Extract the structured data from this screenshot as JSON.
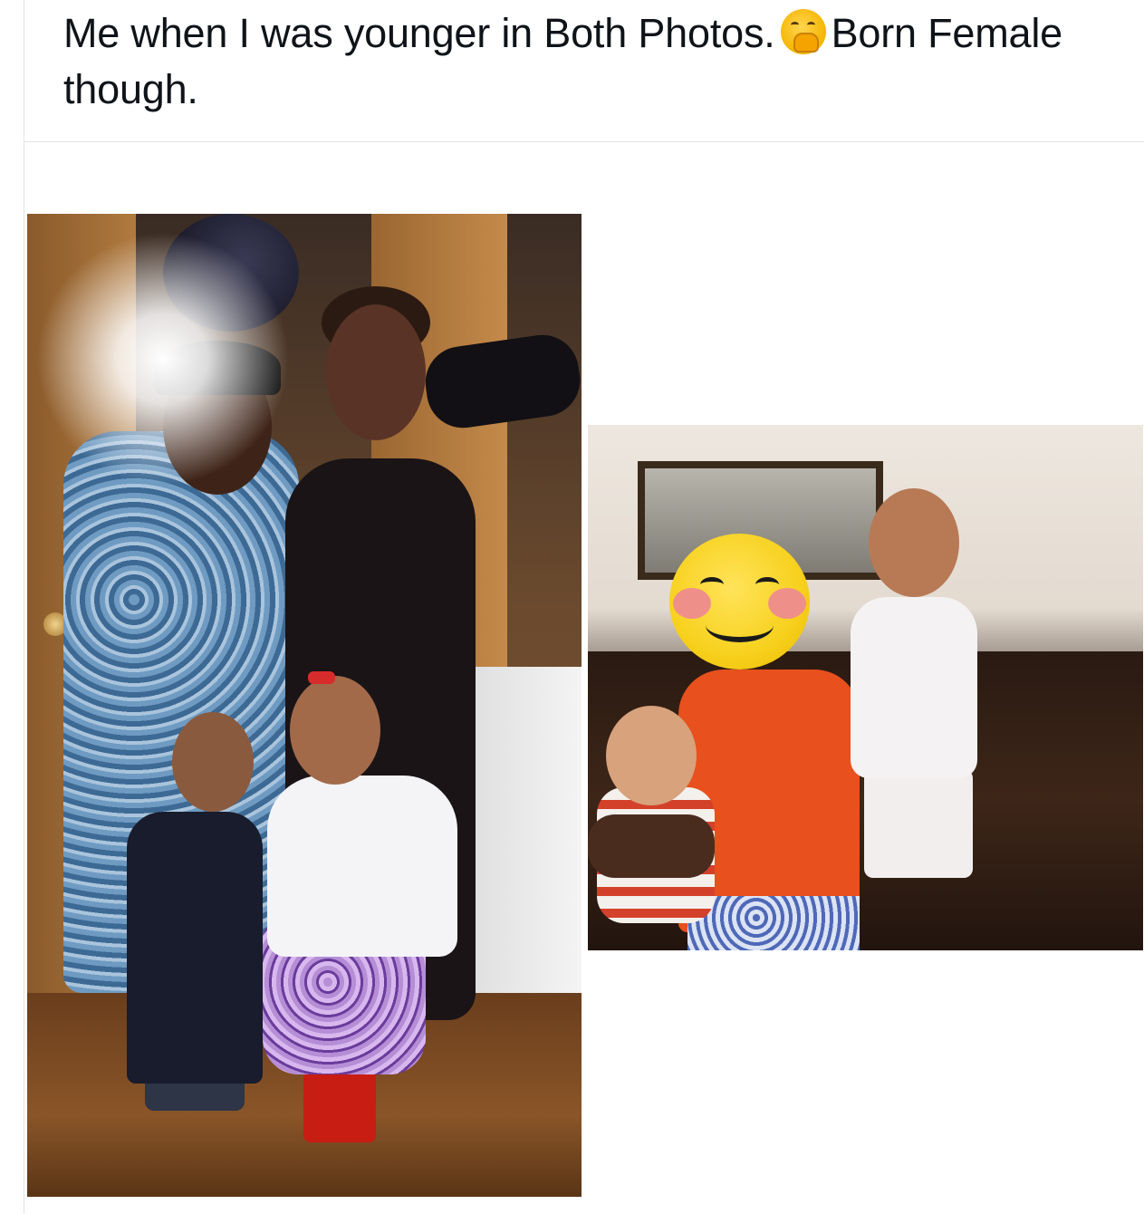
{
  "post": {
    "text_before_emoji": "Me when I was younger in Both Photos.",
    "emoji": "hand-over-mouth-emoji",
    "text_after_emoji": "Born Female though."
  },
  "media": {
    "photo_left": {
      "icon": "family-photo"
    },
    "photo_right": {
      "icon": "family-photo",
      "overlay": "smiling-face-emoji"
    }
  },
  "colors": {
    "text": "#0f1419",
    "divider": "#e1e4e6",
    "background": "#ffffff"
  }
}
